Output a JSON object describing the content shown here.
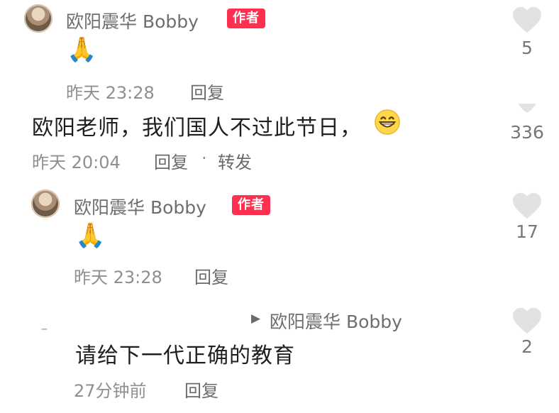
{
  "comments": [
    {
      "author": "欧阳震华 Bobby",
      "badge": "作者",
      "content_emoji": "pray-emoji",
      "time": "昨天 23:28",
      "reply_label": "回复",
      "like_count": "5"
    },
    {
      "content": "欧阳老师，我们国人不过此节日，",
      "content_emoji": "grin-emoji",
      "time": "昨天 20:04",
      "reply_label": "回复",
      "separator": "·",
      "forward_label": "转发",
      "like_count": "336"
    },
    {
      "author": "欧阳震华 Bobby",
      "badge": "作者",
      "content_emoji": "pray-emoji",
      "time": "昨天 23:28",
      "reply_label": "回复",
      "like_count": "17"
    },
    {
      "reply_to_marker": "▶",
      "reply_to": "欧阳震华 Bobby",
      "collapse_marker": "–",
      "content": "请给下一代正确的教育",
      "time": "27分钟前",
      "reply_label": "回复",
      "like_count": "2"
    }
  ],
  "colors": {
    "badge_bg": "#ff2f4f",
    "heart": "#e2e2e2",
    "meta_text": "#8f8f8f"
  }
}
